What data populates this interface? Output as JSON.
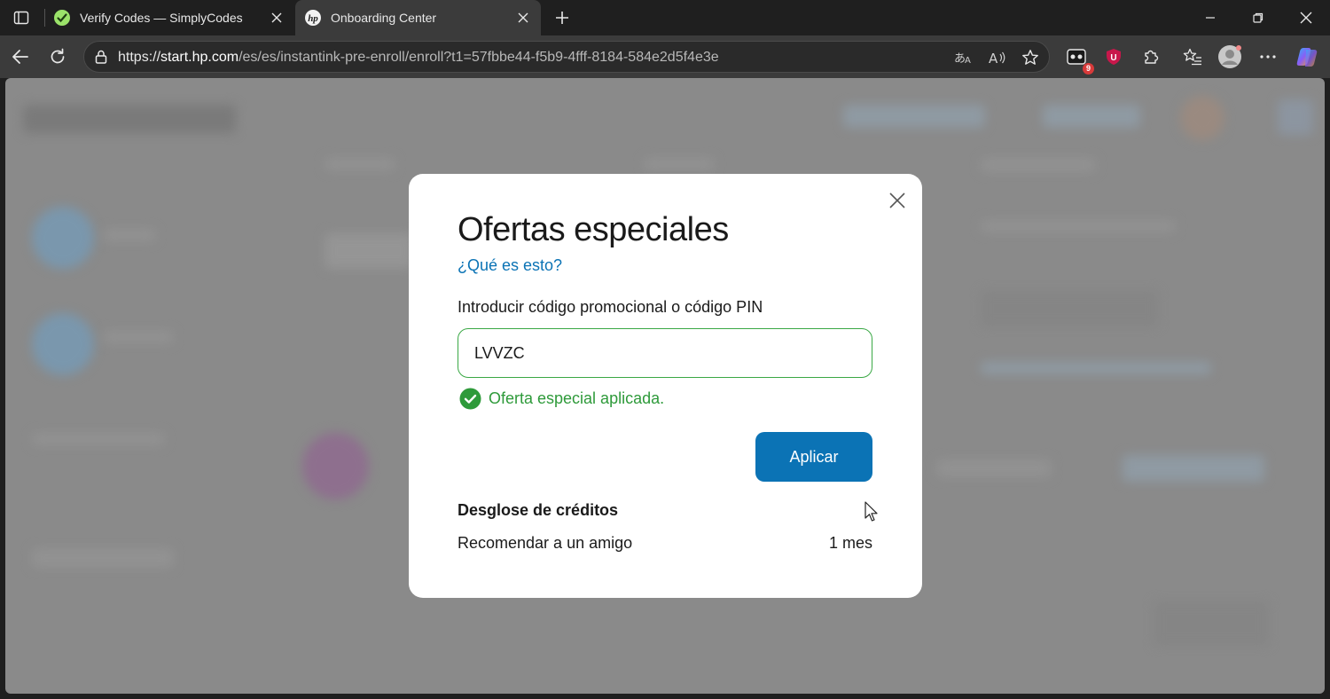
{
  "browser": {
    "tabs": [
      {
        "title": "Verify Codes — SimplyCodes",
        "favicon": "simplycodes-check-icon",
        "active": false
      },
      {
        "title": "Onboarding Center",
        "favicon": "hp-logo-icon",
        "active": true
      }
    ],
    "url": {
      "prefix": "https://",
      "host": "start.hp.com",
      "path": "/es/es/instantink-pre-enroll/enroll?t1=57fbbe44-f5b9-4fff-8184-584e2d5f4e3e"
    },
    "extension_badge_count": "9",
    "colors": {
      "tabstrip": "#1f1f1f",
      "toolbar": "#3b3b3b"
    }
  },
  "modal": {
    "title": "Ofertas especiales",
    "help_link": "¿Qué es esto?",
    "field_label": "Introducir código promocional o código PIN",
    "promo_code_value": "LVVZC",
    "success_message": "Oferta especial aplicada.",
    "apply_button": "Aplicar",
    "breakdown": {
      "title": "Desglose de créditos",
      "items": [
        {
          "label": "Recomendar a un amigo",
          "value": "1 mes"
        }
      ]
    },
    "colors": {
      "primary": "#0b73b5",
      "success": "#2e9a3a",
      "input_border": "#3aa845"
    }
  }
}
